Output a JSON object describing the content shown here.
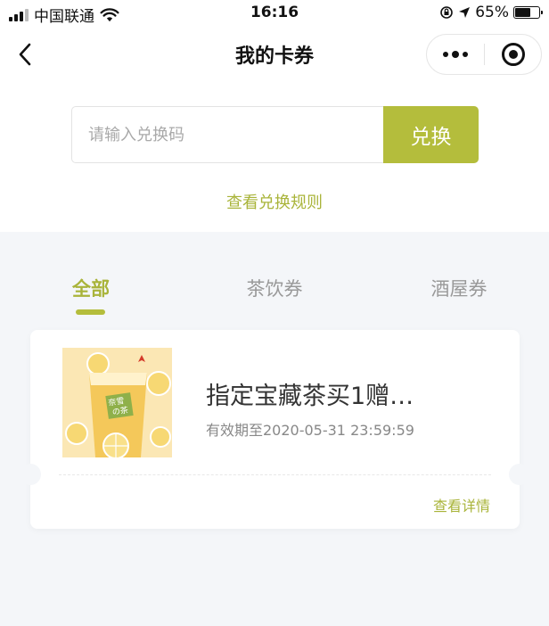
{
  "status_bar": {
    "carrier": "中国联通",
    "time": "16:16",
    "battery_percent": "65%",
    "battery_level": 0.65,
    "icons": [
      "signal-icon",
      "wifi-icon",
      "orientation-lock-icon",
      "location-icon",
      "battery-icon"
    ]
  },
  "nav": {
    "title": "我的卡券",
    "back_icon": "chevron-left-icon",
    "more_icon": "more-dots-icon",
    "close_icon": "target-circle-icon"
  },
  "redeem": {
    "input_placeholder": "请输入兑换码",
    "input_value": "",
    "button_label": "兑换",
    "rules_link": "查看兑换规则"
  },
  "tabs": {
    "items": [
      {
        "label": "全部",
        "active": true
      },
      {
        "label": "茶饮券",
        "active": false
      },
      {
        "label": "酒屋券",
        "active": false
      }
    ]
  },
  "coupons": [
    {
      "title": "指定宝藏茶买1赠…",
      "expiry": "有效期至2020-05-31 23:59:59",
      "details_link": "查看详情",
      "thumb_label_1": "奈雪",
      "thumb_label_2": "の茶"
    }
  ],
  "colors": {
    "accent": "#b4bd3c",
    "accent_text": "#a9b43a",
    "page_background": "#f4f6f9"
  }
}
